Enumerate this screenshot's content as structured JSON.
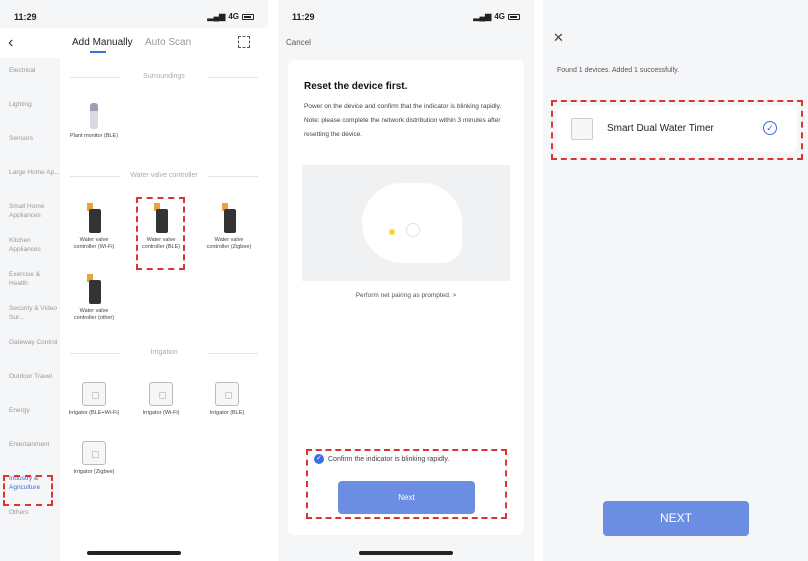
{
  "status_bar": {
    "time": "11:29",
    "network": "4G"
  },
  "panel1": {
    "tabs": {
      "manual": "Add Manually",
      "auto": "Auto Scan"
    },
    "sidebar": [
      "Electrical",
      "Lighting",
      "Sensors",
      "Large Home Ap...",
      "Small Home Appliances",
      "Kitchen Appliances",
      "Exercise & Health",
      "Security & Video Sur...",
      "Gateway Control",
      "Outdoor Travel",
      "Energy",
      "Entertainment",
      "Industry & Agriculture",
      "Others"
    ],
    "active_sidebar_index": 12,
    "sections": {
      "surroundings": "Surroundings",
      "water_valve": "Water valve controller",
      "irrigation": "Irrigation"
    },
    "devices": {
      "plant_monitor": "Plant monitor (BLE)",
      "valve_wifi": "Water valve controller (Wi-Fi)",
      "valve_ble": "Water valve controller (BLE)",
      "valve_zigbee": "Water valve controller (Zigbee)",
      "valve_other": "Water valve controller (other)",
      "irr_ble_wifi": "Irrigator (BLE+Wi-Fi)",
      "irr_wifi": "Irrigator (Wi-Fi)",
      "irr_ble": "Irrigator (BLE)",
      "irr_zigbee": "Irrigator (Zigbee)"
    }
  },
  "panel2": {
    "cancel": "Cancel",
    "title": "Reset the device first.",
    "text": "Power on the device and confirm that the indicator is blinking rapidly. Note: please complete the network distribution within 3 minutes after resetting the device.",
    "perform": "Perform net pairing as prompted. >",
    "confirm": "Confirm the indicator is blinking rapidly.",
    "next": "Next"
  },
  "panel3": {
    "found": "Found 1 devices. Added 1 successfully.",
    "device_name": "Smart Dual Water Timer",
    "next": "NEXT"
  },
  "colors": {
    "accent": "#3b6fd9",
    "button": "#6b8ee3",
    "highlight": "#d33333"
  }
}
